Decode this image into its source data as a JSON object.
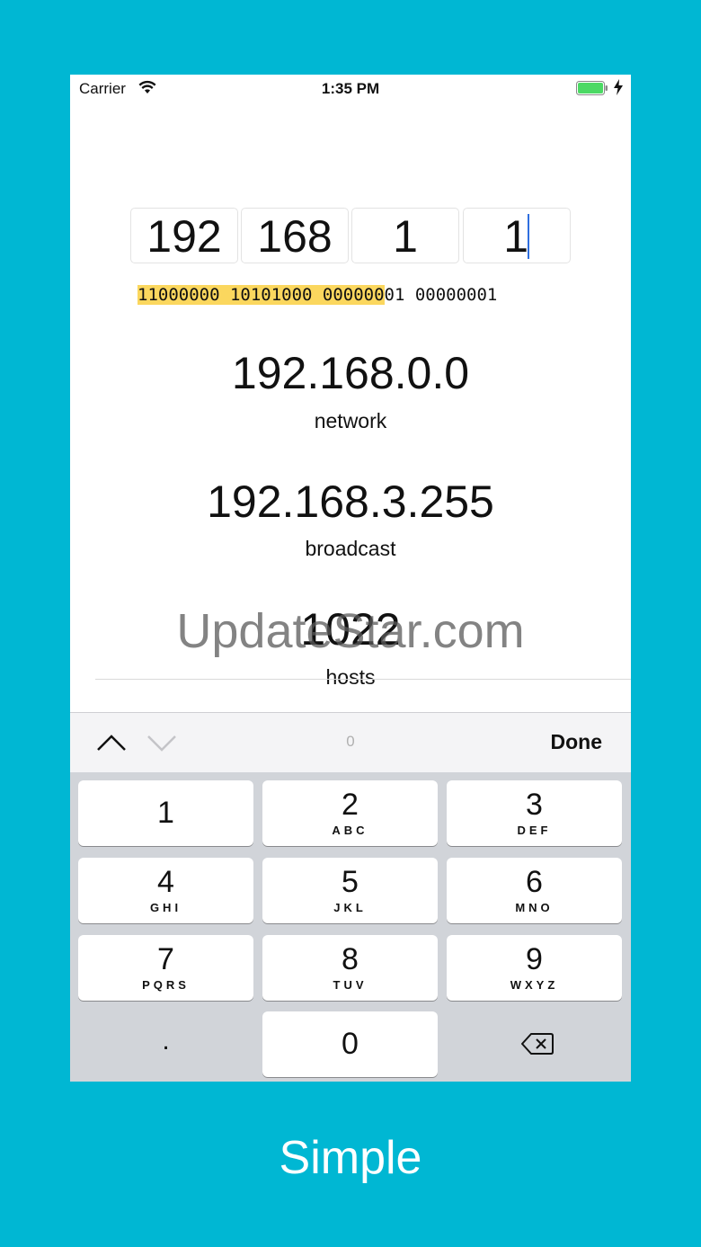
{
  "status_bar": {
    "carrier": "Carrier",
    "time": "1:35 PM"
  },
  "ip_input": {
    "octets": [
      "192",
      "168",
      "1",
      "1"
    ],
    "binary_highlighted": "11000000 10101000 000000",
    "binary_rest": "01 00000001"
  },
  "results": {
    "network_value": "192.168.0.0",
    "network_label": "network",
    "broadcast_value": "192.168.3.255",
    "broadcast_label": "broadcast",
    "hosts_value": "1022",
    "hosts_label": "hosts"
  },
  "watermark": "UpdateStar.com",
  "toolbar": {
    "value": "0",
    "done_label": "Done"
  },
  "keypad": {
    "keys": [
      {
        "digit": "1",
        "letters": ""
      },
      {
        "digit": "2",
        "letters": "ABC"
      },
      {
        "digit": "3",
        "letters": "DEF"
      },
      {
        "digit": "4",
        "letters": "GHI"
      },
      {
        "digit": "5",
        "letters": "JKL"
      },
      {
        "digit": "6",
        "letters": "MNO"
      },
      {
        "digit": "7",
        "letters": "PQRS"
      },
      {
        "digit": "8",
        "letters": "TUV"
      },
      {
        "digit": "9",
        "letters": "WXYZ"
      }
    ],
    "dot": ".",
    "zero": "0"
  },
  "caption": "Simple",
  "colors": {
    "background": "#00b7d3",
    "highlight": "#fbd75e",
    "cursor": "#2f6fdf",
    "battery": "#4cd964"
  }
}
